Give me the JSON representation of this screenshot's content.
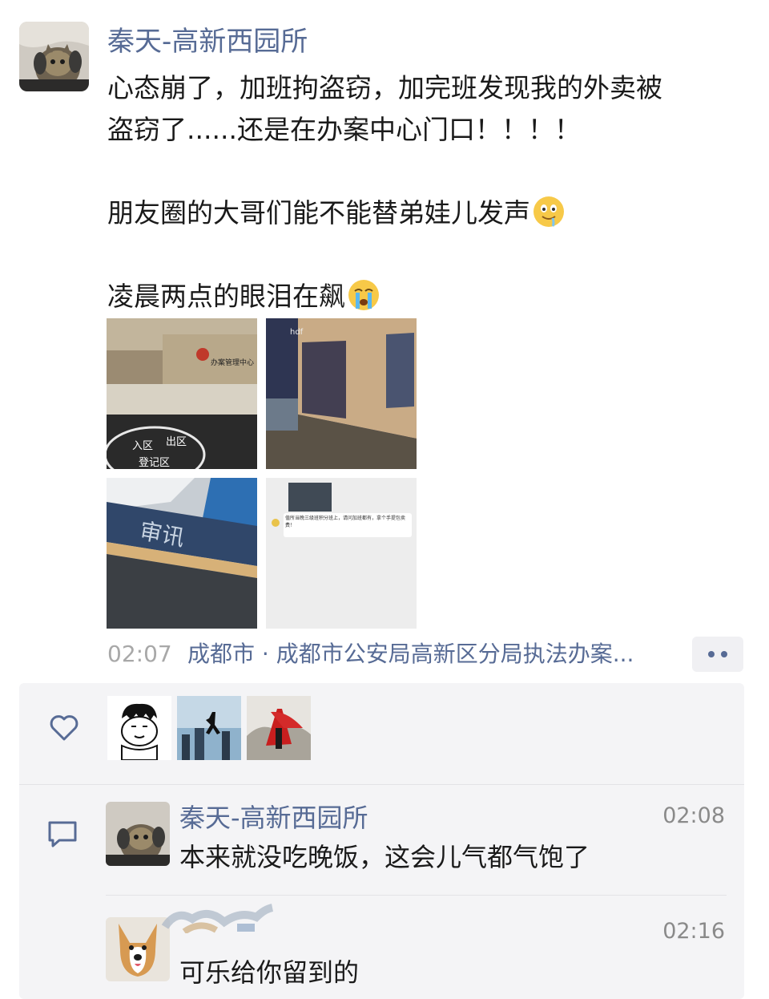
{
  "post": {
    "author": "秦天-高新西园所",
    "text_line1": "心态崩了，加班拘盗窃，加完班发现我的外卖被",
    "text_line2": "盗窃了......还是在办案中心门口！！！！",
    "text_line3": "朋友圈的大哥们能不能替弟娃儿发声",
    "text_line4": "凌晨两点的眼泪在飙",
    "emoji_1": "drooling-face-emoji",
    "emoji_2": "crying-face-emoji",
    "photos": [
      {
        "sign_text": "办案管理中心",
        "floor_labels": [
          "入区",
          "出区",
          "登记区"
        ]
      },
      {
        "sign_text": "hdf"
      },
      {
        "desk_label": "审讯"
      },
      {
        "chat_text": "值所当晚三级班积分班上，请问加班都有，拿个手提包卖费！"
      }
    ],
    "time": "02:07",
    "location": "成都市 · 成都市公安局高新区分局执法办案..."
  },
  "likes": {
    "icon": "heart-outline-icon",
    "avatars": [
      "cartoon-man-avatar",
      "city-skyline-avatar",
      "red-cape-hero-avatar"
    ]
  },
  "comments": [
    {
      "name": "秦天-高新西园所",
      "time": "02:08",
      "text": "本来就没吃晚饭，这会儿气都气饱了"
    },
    {
      "name": "",
      "time": "02:16",
      "text": "可乐给你留到的"
    }
  ],
  "colors": {
    "link": "#576b95",
    "panel": "#f4f4f6",
    "time": "#a8a8a8"
  }
}
